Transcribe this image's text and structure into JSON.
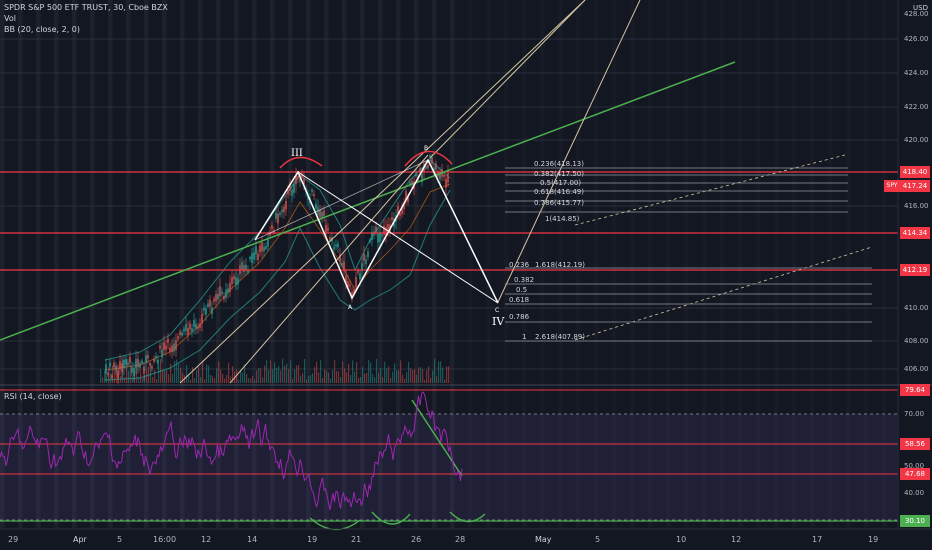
{
  "header": {
    "symbol_line": "SPDR S&P 500 ETF TRUST, 30, Cboe BZX",
    "vol_label": "Vol",
    "bb_label": "BB (20, close, 2, 0)",
    "currency": "USD"
  },
  "rsi": {
    "label": "RSI (14, close)",
    "ticks": [
      "70.00",
      "60.00",
      "50.00",
      "40.00"
    ],
    "badges": [
      {
        "text": "79.64",
        "color": "#f23645"
      },
      {
        "text": "58.56",
        "color": "#f23645"
      },
      {
        "text": "47.68",
        "color": "#f23645"
      },
      {
        "text": "30.10",
        "color": "#4caf50"
      }
    ]
  },
  "price_axis": {
    "ticks": [
      "428.00",
      "426.00",
      "424.00",
      "422.00",
      "420.00",
      "416.00",
      "410.00",
      "408.00",
      "406.00"
    ],
    "badges": [
      {
        "text": "418.40",
        "color": "#f23645"
      },
      {
        "text": "417.24",
        "color": "#f23645",
        "tag": "SPY"
      },
      {
        "text": "414.34",
        "color": "#f23645"
      },
      {
        "text": "412.19",
        "color": "#f23645"
      }
    ]
  },
  "time_axis": [
    "29",
    "Apr",
    "5",
    "16:00",
    "12",
    "14",
    "19",
    "21",
    "26",
    "28",
    "May",
    "5",
    "10",
    "12",
    "17",
    "19"
  ],
  "wave_labels": {
    "iii": "III",
    "a": "A",
    "b": "B",
    "c": "C",
    "iv": "IV"
  },
  "fib_upper": [
    "0.236(418.13)",
    "0.382(417.50)",
    "0.5(417.00)",
    "0.618(416.49)",
    "0.786(415.77)",
    "1(414.85)"
  ],
  "fib_lower": [
    "0.236",
    "1.618(412.19)",
    "0.382",
    "0.5",
    "0.618",
    "0.786",
    "1",
    "2.618(407.89)"
  ],
  "colors": {
    "background": "#131722",
    "red_line": "#f23645",
    "green_line": "#4caf50",
    "rsi_line": "#9c27b0",
    "wave_white": "#ffffff",
    "fan_line": "#d6c7a1"
  }
}
